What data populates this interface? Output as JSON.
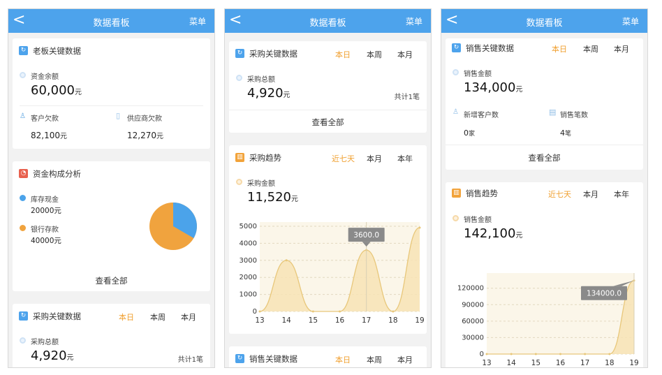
{
  "common": {
    "back_glyph": "<",
    "header_title": "数据看板",
    "menu_label": "菜单",
    "view_all": "查看全部",
    "unit_yuan": "元"
  },
  "panel1": {
    "boss": {
      "title": "老板关键数据",
      "cash_label": "资金余额",
      "cash_value": "60,000",
      "recv_label": "客户欠款",
      "recv_value": "82,100",
      "pay_label": "供应商欠款",
      "pay_value": "12,270"
    },
    "capital": {
      "title": "资金构成分析",
      "items": [
        {
          "label": "库存现金",
          "value": "20000元",
          "color": "#4ba3ea"
        },
        {
          "label": "银行存款",
          "value": "40000元",
          "color": "#f0a33e"
        }
      ]
    },
    "purchase": {
      "title": "采购关键数据",
      "tabs": [
        "本日",
        "本周",
        "本月"
      ],
      "total_label": "采购总额",
      "total_value": "4,920",
      "count": "共计1笔"
    }
  },
  "panel2": {
    "purchase": {
      "title": "采购关键数据",
      "tabs": [
        "本日",
        "本周",
        "本月"
      ],
      "total_label": "采购总额",
      "total_value": "4,920",
      "count": "共计1笔"
    },
    "trend": {
      "title": "采购趋势",
      "tabs": [
        "近七天",
        "本月",
        "本年"
      ],
      "amount_label": "采购金额",
      "amount_value": "11,520",
      "tooltip": "3600.0"
    },
    "sales_header": {
      "title": "销售关键数据",
      "tabs": [
        "本日",
        "本周",
        "本月"
      ]
    }
  },
  "panel3": {
    "sales": {
      "title": "销售关键数据",
      "tabs": [
        "本日",
        "本周",
        "本月"
      ],
      "amount_label": "销售金额",
      "amount_value": "134,000",
      "new_cust_label": "新增客户数",
      "new_cust_value": "0",
      "new_cust_unit": "家",
      "orders_label": "销售笔数",
      "orders_value": "4",
      "orders_unit": "笔"
    },
    "trend": {
      "title": "销售趋势",
      "tabs": [
        "近七天",
        "本月",
        "本年"
      ],
      "amount_label": "销售金额",
      "amount_value": "142,100",
      "tooltip": "134000.0"
    }
  },
  "chart_data": [
    {
      "type": "area",
      "x": [
        13,
        14,
        15,
        16,
        17,
        18,
        19
      ],
      "series": [
        {
          "values": [
            0,
            3000,
            0,
            0,
            3600,
            0,
            4920
          ]
        }
      ],
      "ylim": [
        0,
        5000
      ],
      "yticks": [
        0,
        1000,
        2000,
        3000,
        4000,
        5000
      ],
      "highlight": {
        "x": 17,
        "label": "3600.0"
      },
      "colors": {
        "fill": "#f7e3b5",
        "line": "#e8c77a"
      }
    },
    {
      "type": "area",
      "x": [
        13,
        14,
        15,
        16,
        17,
        18,
        19
      ],
      "series": [
        {
          "values": [
            0,
            0,
            0,
            0,
            0,
            0,
            134000
          ]
        }
      ],
      "ylim": [
        0,
        140000
      ],
      "yticks": [
        0,
        30000,
        60000,
        90000,
        120000
      ],
      "highlight": {
        "x": 19,
        "label": "134000.0"
      },
      "colors": {
        "fill": "#f7e3b5",
        "line": "#e8c77a"
      }
    }
  ]
}
